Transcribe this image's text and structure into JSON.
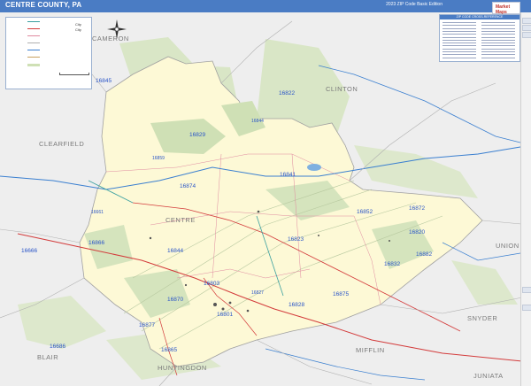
{
  "header": {
    "title": "CENTRE COUNTY, PA",
    "edition": "2023 ZIP Code Basic Edition"
  },
  "legend": {
    "title": "City",
    "city_major": "City",
    "city_minor": "City"
  },
  "index": {
    "heading": "ZIP CODE CROSS-REFERENCE"
  },
  "logo": {
    "text": "Market Maps"
  },
  "counties": {
    "centre": "CENTRE",
    "clearfield": "CLEARFIELD",
    "clinton": "CLINTON",
    "union": "UNION",
    "snyder": "SNYDER",
    "mifflin": "MIFFLIN",
    "juniata": "JUNIATA",
    "huntingdon": "HUNTINGDON",
    "blair": "BLAIR",
    "cameron": "CAMERON"
  },
  "zips": {
    "z16845": "16845",
    "z16822": "16822",
    "z16844a": "16844",
    "z16829": "16829",
    "z16859": "16859",
    "z16874": "16874",
    "z16841": "16841",
    "z16852": "16852",
    "z16872": "16872",
    "z16820": "16820",
    "z16882": "16882",
    "z16832": "16832",
    "z16823": "16823",
    "z16844b": "16844",
    "z16866": "16866",
    "z16666": "16666",
    "z16875": "16875",
    "z16827": "16827",
    "z16803": "16803",
    "z16870": "16870",
    "z16801": "16801",
    "z16828": "16828",
    "z16877": "16877",
    "z16686": "16686",
    "z16865": "16865",
    "z16661": "16661"
  },
  "colors": {
    "title_bar": "#4a7cc4",
    "county_fill": "#fdf9d6",
    "outside_fill": "#eeeeee",
    "forest": "#c9dcb0",
    "river": "#3a7fd0",
    "highway_red": "#d33b3b",
    "zip_text": "#2a55c8"
  }
}
